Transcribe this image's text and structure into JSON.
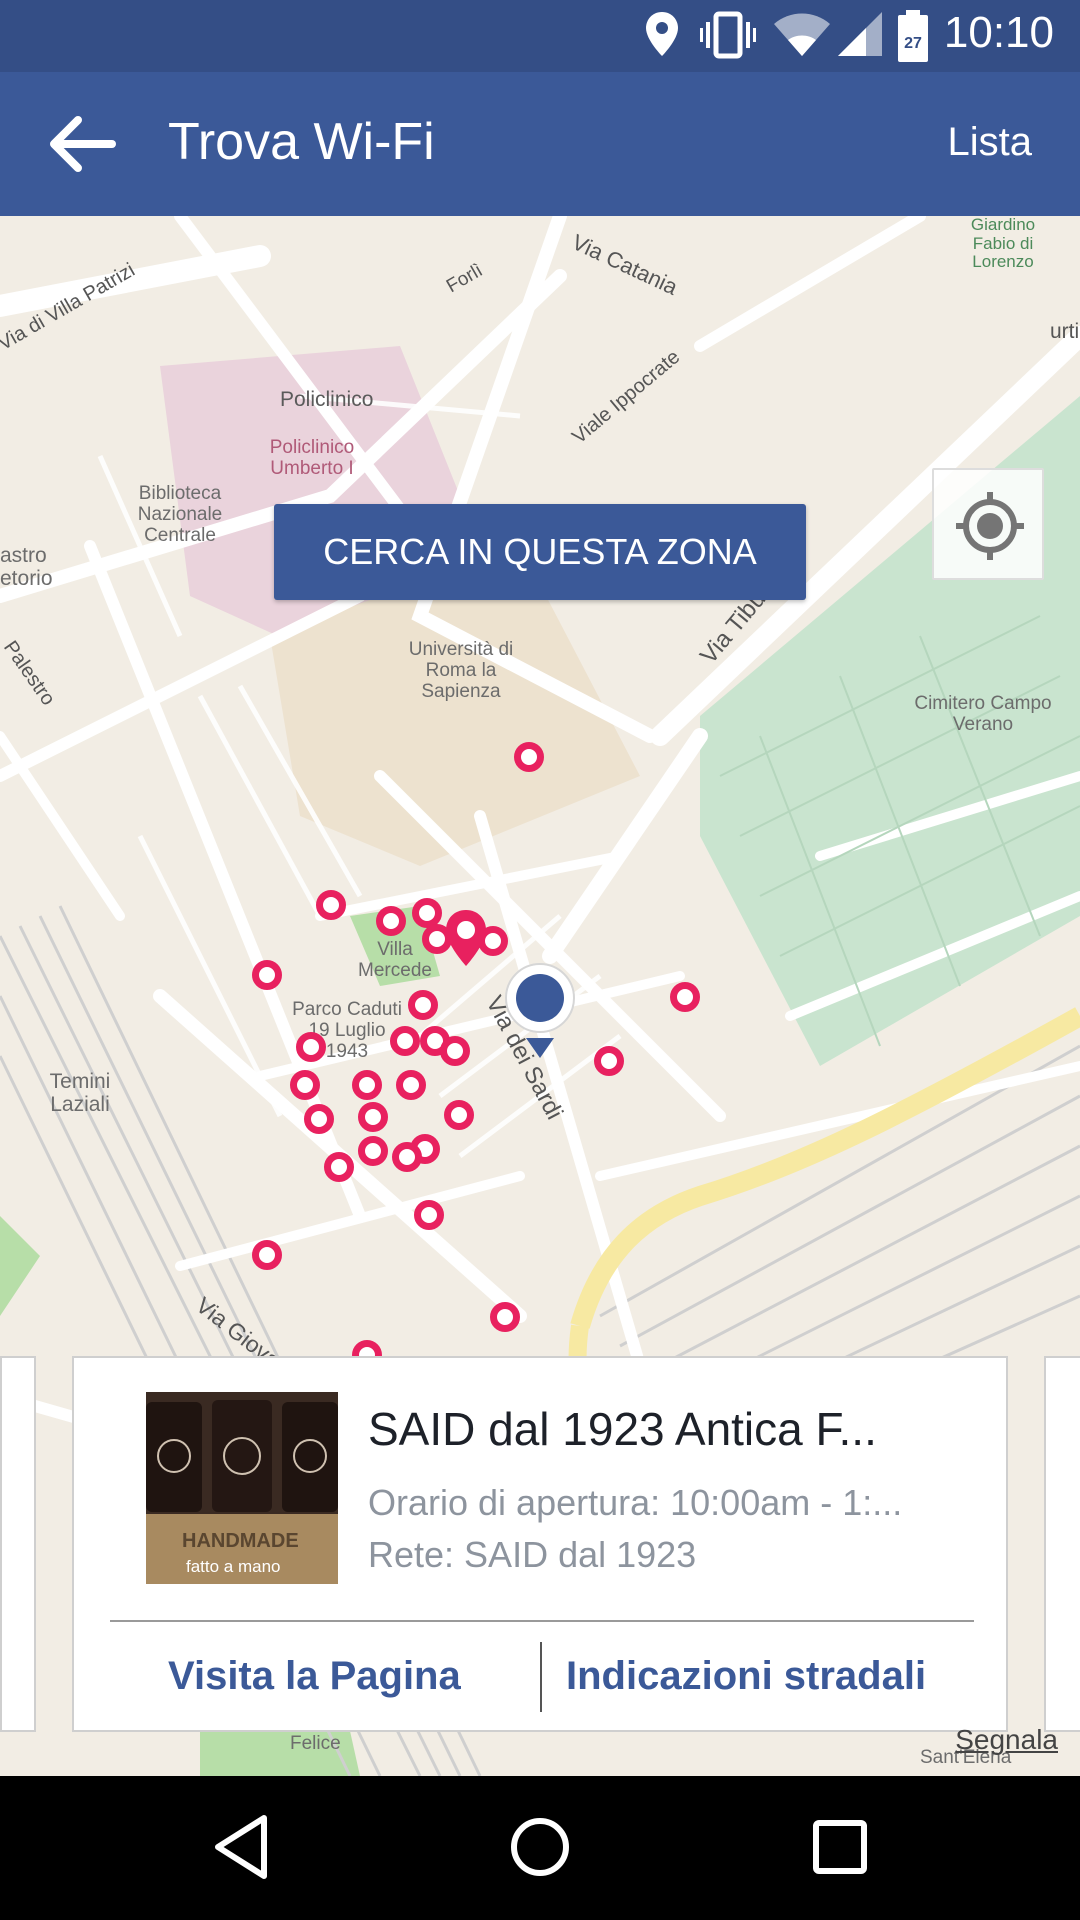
{
  "status_bar": {
    "time": "10:10",
    "battery_level": "27"
  },
  "app_bar": {
    "title": "Trova Wi-Fi",
    "action": "Lista"
  },
  "map": {
    "search_button": "CERCA IN QUESTA ZONA",
    "labels": {
      "policlinico": "Policlinico",
      "policlinico_umberto": "Policlinico Umberto I",
      "biblioteca": "Biblioteca Nazionale Centrale",
      "universita": "Università di Roma la Sapienza",
      "cimitero": "Cimitero Campo Verano",
      "villa_mercede": "Villa Mercede",
      "parco": "Parco Caduti 19 Luglio 1943",
      "termini": "Temini Laziali",
      "castro": "astro etorio",
      "giardino": "Giardino Fabio di Lorenzo",
      "felice": "Felice",
      "sant_elena": "Sant'Elena"
    },
    "streets": {
      "villa_patrizi": "Via di Villa Patrizi",
      "forli": "Forlì",
      "catania": "Via Catania",
      "ippocrate": "Viale Ippocrate",
      "tiburtina": "Via Tiburtina",
      "tiburtina_short": "urti",
      "palestro": "Palestro",
      "sardi": "Via dei Sardi",
      "giovanni_giolitti": "Via Giovanni Gi"
    }
  },
  "card": {
    "name": "SAID dal 1923 Antica F...",
    "hours": "Orario di apertura: 10:00am - 1:...",
    "network": "Rete: SAID dal 1923",
    "thumb_label_1": "HANDMADE",
    "thumb_label_2": "fatto a mano",
    "visit_button": "Visita la Pagina",
    "directions_button": "Indicazioni stradali"
  },
  "report_link": "Segnala",
  "colors": {
    "brand": "#3b5998",
    "status": "#344e86",
    "pin": "#e8215f",
    "park": "#c9e4cf",
    "map_bg": "#f2ede4"
  }
}
